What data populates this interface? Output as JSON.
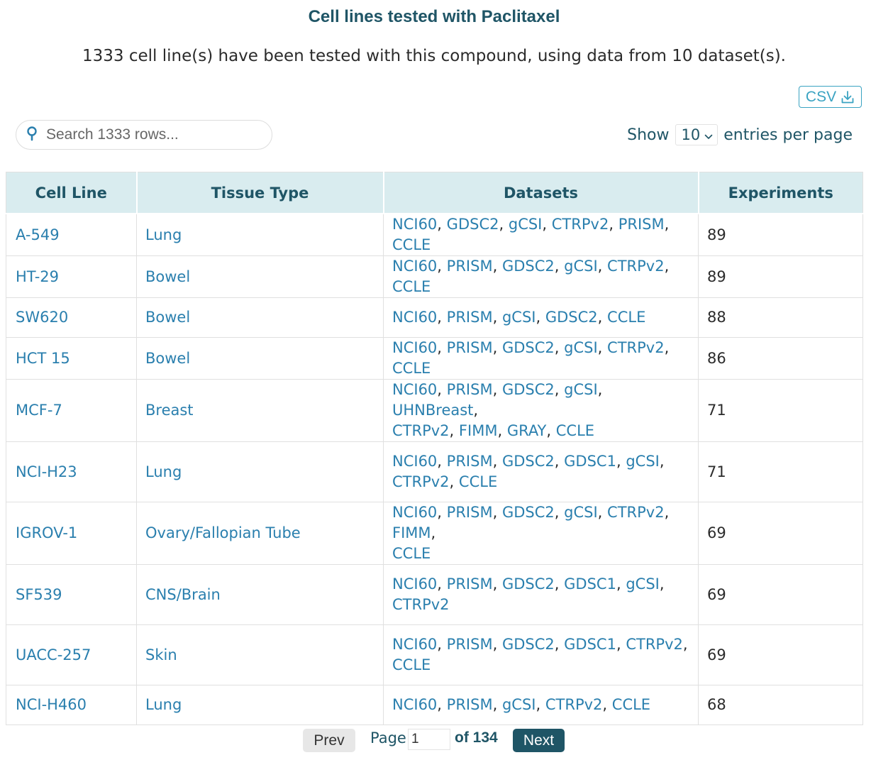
{
  "title": "Cell lines tested with Paclitaxel",
  "subtitle": "1333 cell line(s) have been tested with this compound, using data from 10 dataset(s).",
  "csv_button": {
    "label": "CSV",
    "icon": "download-icon"
  },
  "search": {
    "placeholder": "Search 1333 rows...",
    "value": "",
    "icon": "search-icon"
  },
  "entries": {
    "show_label": "Show",
    "selected": "10",
    "suffix": "entries per page"
  },
  "colors": {
    "header_bg": "#d9ecef",
    "header_text": "#1f5566",
    "link": "#2a7fae",
    "accent": "#3aa3c2",
    "next_bg": "#1f5566"
  },
  "table": {
    "headers": [
      "Cell Line",
      "Tissue Type",
      "Datasets",
      "Experiments"
    ],
    "rows": [
      {
        "cell_line": "A-549",
        "tissue": "Lung",
        "datasets": [
          "NCI60",
          "GDSC2",
          "gCSI",
          "CTRPv2",
          "PRISM",
          "CCLE"
        ],
        "experiments": "89"
      },
      {
        "cell_line": "HT-29",
        "tissue": "Bowel",
        "datasets": [
          "NCI60",
          "PRISM",
          "GDSC2",
          "gCSI",
          "CTRPv2",
          "CCLE"
        ],
        "experiments": "89"
      },
      {
        "cell_line": "SW620",
        "tissue": "Bowel",
        "datasets": [
          "NCI60",
          "PRISM",
          "gCSI",
          "GDSC2",
          "CCLE"
        ],
        "experiments": "88"
      },
      {
        "cell_line": "HCT 15",
        "tissue": "Bowel",
        "datasets": [
          "NCI60",
          "PRISM",
          "GDSC2",
          "gCSI",
          "CTRPv2",
          "CCLE"
        ],
        "experiments": "86"
      },
      {
        "cell_line": "MCF-7",
        "tissue": "Breast",
        "datasets": [
          "NCI60",
          "PRISM",
          "GDSC2",
          "gCSI",
          "UHNBreast",
          "CTRPv2",
          "FIMM",
          "GRAY",
          "CCLE"
        ],
        "experiments": "71"
      },
      {
        "cell_line": "NCI-H23",
        "tissue": "Lung",
        "datasets": [
          "NCI60",
          "PRISM",
          "GDSC2",
          "GDSC1",
          "gCSI",
          "CTRPv2",
          "CCLE"
        ],
        "experiments": "71"
      },
      {
        "cell_line": "IGROV-1",
        "tissue": "Ovary/Fallopian Tube",
        "datasets": [
          "NCI60",
          "PRISM",
          "GDSC2",
          "gCSI",
          "CTRPv2",
          "FIMM",
          "CCLE"
        ],
        "experiments": "69"
      },
      {
        "cell_line": "SF539",
        "tissue": "CNS/Brain",
        "datasets": [
          "NCI60",
          "PRISM",
          "GDSC2",
          "GDSC1",
          "gCSI",
          "CTRPv2"
        ],
        "experiments": "69"
      },
      {
        "cell_line": "UACC-257",
        "tissue": "Skin",
        "datasets": [
          "NCI60",
          "PRISM",
          "GDSC2",
          "GDSC1",
          "CTRPv2",
          "CCLE"
        ],
        "experiments": "69"
      },
      {
        "cell_line": "NCI-H460",
        "tissue": "Lung",
        "datasets": [
          "NCI60",
          "PRISM",
          "gCSI",
          "CTRPv2",
          "CCLE"
        ],
        "experiments": "68"
      }
    ]
  },
  "pagination": {
    "prev_label": "Prev",
    "page_label": "Page",
    "current_page": "1",
    "of_label": "of 134",
    "next_label": "Next"
  }
}
